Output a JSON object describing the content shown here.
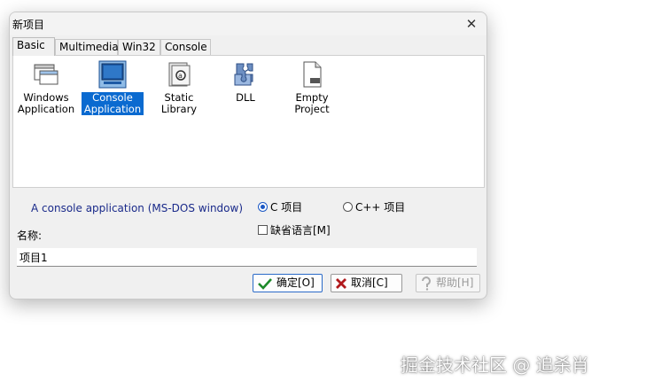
{
  "window": {
    "title": "新项目"
  },
  "tabs": [
    {
      "label": "Basic",
      "active": true
    },
    {
      "label": "Multimedia",
      "active": false
    },
    {
      "label": "Win32",
      "active": false
    },
    {
      "label": "Console",
      "active": false
    }
  ],
  "project_types": [
    {
      "label_line1": "Windows",
      "label_line2": "Application",
      "icon": "windows-app-icon",
      "selected": false
    },
    {
      "label_line1": "Console",
      "label_line2": "Application",
      "icon": "console-app-icon",
      "selected": true
    },
    {
      "label_line1": "Static Library",
      "label_line2": "",
      "icon": "static-library-icon",
      "selected": false
    },
    {
      "label_line1": "DLL",
      "label_line2": "",
      "icon": "dll-icon",
      "selected": false
    },
    {
      "label_line1": "Empty Project",
      "label_line2": "",
      "icon": "empty-project-icon",
      "selected": false
    }
  ],
  "description": "A console application (MS-DOS window)",
  "language": {
    "c_label": "C 项目",
    "cpp_label": "C++ 项目",
    "selected": "C"
  },
  "default_language_label": "缺省语言[M]",
  "name": {
    "label": "名称:",
    "value": "项目1"
  },
  "buttons": {
    "ok": "确定[O]",
    "cancel": "取消[C]",
    "help": "帮助[H]"
  },
  "watermark": "掘金技术社区 @ 追杀肖",
  "colors": {
    "selection": "#0a6ad0",
    "accent": "#2a6ac8",
    "description": "#1a2a8a"
  }
}
